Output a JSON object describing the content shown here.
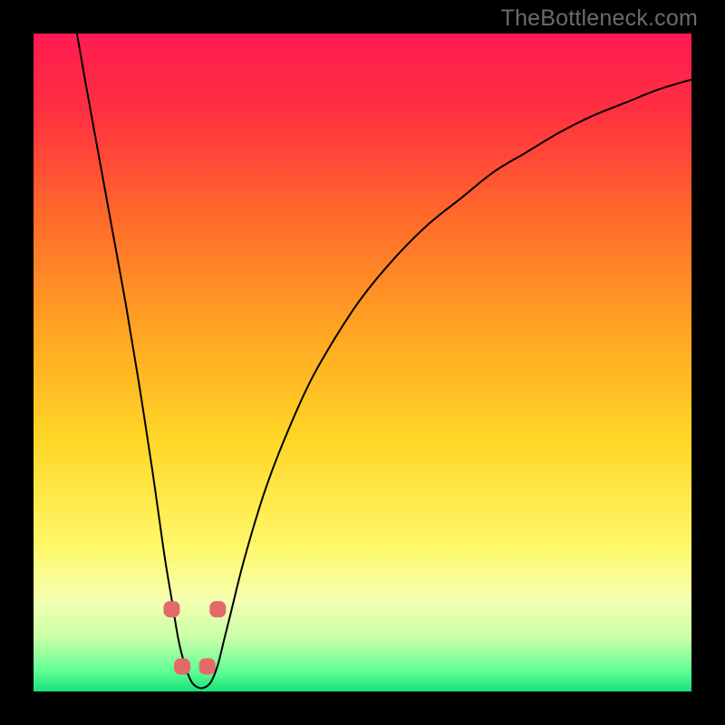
{
  "watermark": "TheBottleneck.com",
  "chart_data": {
    "type": "line",
    "title": "",
    "xlabel": "",
    "ylabel": "",
    "xlim": [
      0,
      100
    ],
    "ylim": [
      0,
      100
    ],
    "grid": false,
    "legend": false,
    "background_gradient": {
      "stops": [
        {
          "offset": 0.0,
          "color": "#ff1a52"
        },
        {
          "offset": 0.12,
          "color": "#ff3040"
        },
        {
          "offset": 0.28,
          "color": "#ff6a2a"
        },
        {
          "offset": 0.45,
          "color": "#ffa422"
        },
        {
          "offset": 0.62,
          "color": "#ffd727"
        },
        {
          "offset": 0.78,
          "color": "#fff86a"
        },
        {
          "offset": 0.86,
          "color": "#f5ffb0"
        },
        {
          "offset": 0.92,
          "color": "#c8ffa8"
        },
        {
          "offset": 0.97,
          "color": "#5dff93"
        },
        {
          "offset": 1.0,
          "color": "#17e07a"
        }
      ]
    },
    "series": [
      {
        "name": "bottleneck-curve",
        "color": "#000000",
        "width": 2,
        "x": [
          6.6,
          8,
          10,
          12,
          14,
          16,
          18,
          19,
          20,
          21,
          22,
          23,
          24,
          25,
          26,
          27,
          28,
          29,
          30,
          32,
          35,
          38,
          42,
          46,
          50,
          55,
          60,
          65,
          70,
          75,
          80,
          85,
          90,
          95,
          100
        ],
        "y": [
          100,
          92,
          81,
          70,
          59,
          47,
          34,
          27,
          20,
          14,
          8,
          4,
          1.5,
          0.6,
          0.6,
          1.5,
          4,
          8,
          12,
          20,
          30,
          38,
          47,
          54,
          60,
          66,
          71,
          75,
          79,
          82,
          85,
          87.5,
          89.5,
          91.5,
          93
        ]
      }
    ],
    "markers": {
      "name": "highlight-dots",
      "color": "#e46a6a",
      "radius": 9,
      "points": [
        {
          "x": 21.0,
          "y": 12.5
        },
        {
          "x": 22.6,
          "y": 3.8
        },
        {
          "x": 26.4,
          "y": 3.8
        },
        {
          "x": 28.0,
          "y": 12.5
        }
      ]
    }
  }
}
